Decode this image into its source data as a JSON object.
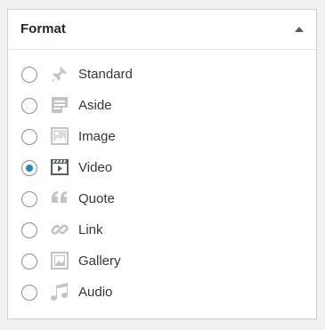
{
  "panel": {
    "title": "Format",
    "toggle_icon": "triangle-up-icon",
    "colors": {
      "icon_inactive": "#c3c4c7",
      "icon_active": "#555d66",
      "radio_checked": "#1e8cbe"
    }
  },
  "formats": [
    {
      "label": "Standard",
      "icon": "pin-icon",
      "checked": false
    },
    {
      "label": "Aside",
      "icon": "aside-icon",
      "checked": false
    },
    {
      "label": "Image",
      "icon": "image-icon",
      "checked": false
    },
    {
      "label": "Video",
      "icon": "video-icon",
      "checked": true
    },
    {
      "label": "Quote",
      "icon": "quote-icon",
      "checked": false
    },
    {
      "label": "Link",
      "icon": "link-icon",
      "checked": false
    },
    {
      "label": "Gallery",
      "icon": "gallery-icon",
      "checked": false
    },
    {
      "label": "Audio",
      "icon": "audio-icon",
      "checked": false
    }
  ]
}
